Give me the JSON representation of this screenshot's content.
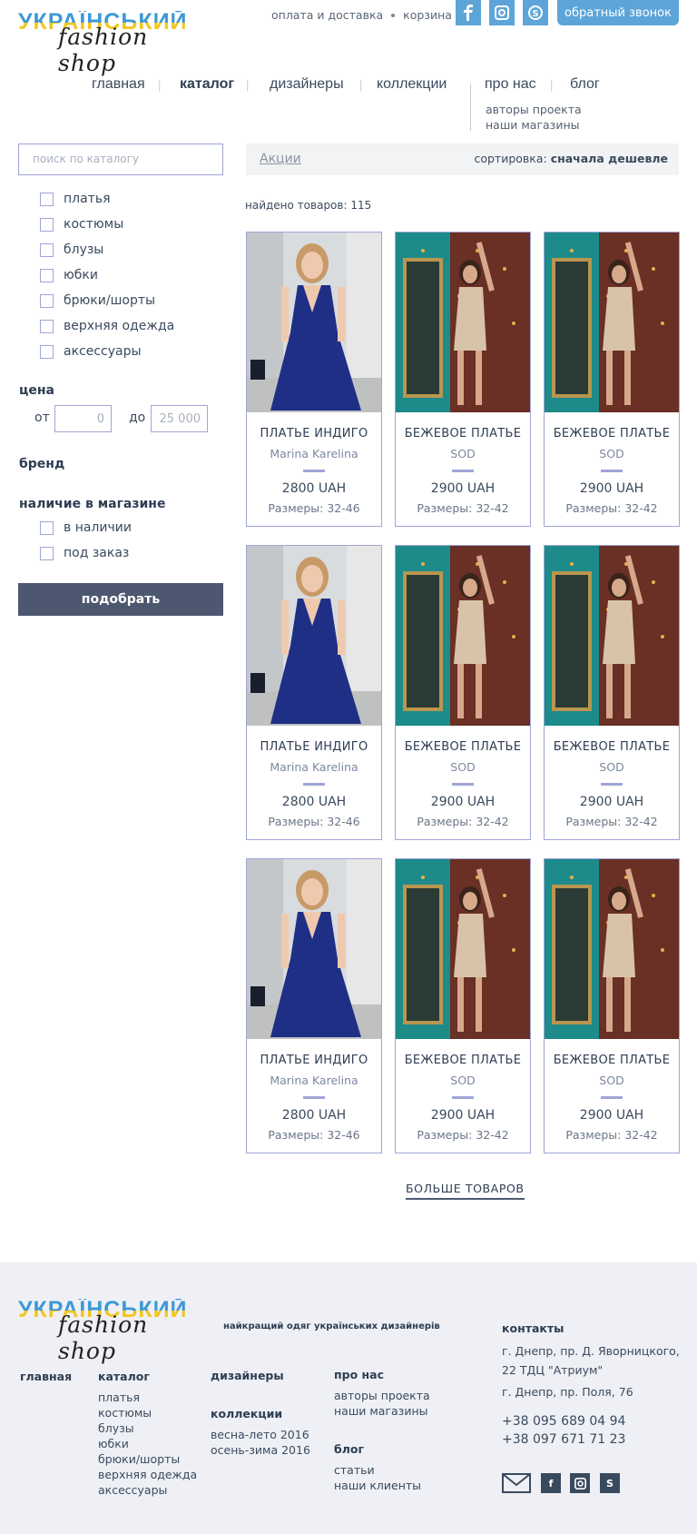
{
  "logo": {
    "line1": "УКРАЇНСЬКИЙ",
    "line2": "fashion shop"
  },
  "header": {
    "delivery_link": "оплата и доставка",
    "cart_link": "корзина (0)",
    "callback_button": "обратный звонок",
    "social": [
      "facebook-icon",
      "instagram-icon",
      "skype-icon"
    ]
  },
  "nav": {
    "items": [
      "главная",
      "каталог",
      "дизайнеры",
      "коллекции",
      "про нас",
      "блог"
    ],
    "active": "каталог",
    "sub_about": [
      "авторы проекта",
      "наши магазины"
    ]
  },
  "sidebar": {
    "search_placeholder": "поиск по каталогу",
    "categories": [
      "платья",
      "костюмы",
      "блузы",
      "юбки",
      "брюки/шорты",
      "верхняя одежда",
      "аксессуары"
    ],
    "price_label": "цена",
    "from_label": "от",
    "to_label": "до",
    "price_from": "0",
    "price_to": "25 000",
    "brand_label": "бренд",
    "stock_label": "наличие в магазине",
    "stock_options": [
      "в наличии",
      "под заказ"
    ],
    "apply_button": "подобрать"
  },
  "toolbar": {
    "promo_link": "Акции",
    "sort_label": "сортировка:",
    "sort_value": "сначала дешевле"
  },
  "found_text": "найдено товаров: 115",
  "products": [
    {
      "name": "ПЛАТЬЕ ИНДИГО",
      "brand": "Marina Karelina",
      "price": "2800 UAH",
      "sizes": "Размеры: 32-46"
    },
    {
      "name": "БЕЖЕВОЕ ПЛАТЬЕ",
      "brand": "SOD",
      "price": "2900 UAH",
      "sizes": "Размеры: 32-42"
    },
    {
      "name": "БЕЖЕВОЕ ПЛАТЬЕ",
      "brand": "SOD",
      "price": "2900 UAH",
      "sizes": "Размеры: 32-42"
    },
    {
      "name": "ПЛАТЬЕ ИНДИГО",
      "brand": "Marina Karelina",
      "price": "2800 UAH",
      "sizes": "Размеры: 32-46"
    },
    {
      "name": "БЕЖЕВОЕ ПЛАТЬЕ",
      "brand": "SOD",
      "price": "2900 UAH",
      "sizes": "Размеры: 32-42"
    },
    {
      "name": "БЕЖЕВОЕ ПЛАТЬЕ",
      "brand": "SOD",
      "price": "2900 UAH",
      "sizes": "Размеры: 32-42"
    },
    {
      "name": "ПЛАТЬЕ ИНДИГО",
      "brand": "Marina Karelina",
      "price": "2800 UAH",
      "sizes": "Размеры: 32-46"
    },
    {
      "name": "БЕЖЕВОЕ ПЛАТЬЕ",
      "brand": "SOD",
      "price": "2900 UAH",
      "sizes": "Размеры: 32-42"
    },
    {
      "name": "БЕЖЕВОЕ ПЛАТЬЕ",
      "brand": "SOD",
      "price": "2900 UAH",
      "sizes": "Размеры: 32-42"
    }
  ],
  "more_button": "БОЛЬШЕ ТОВАРОВ",
  "footer": {
    "tagline": "найкращий одяг українських дизайнерів",
    "col_main": "главная",
    "col_catalog": "каталог",
    "catalog_items": [
      "платья",
      "костюмы",
      "блузы",
      "юбки",
      "брюки/шорты",
      "верхняя одежда",
      "аксессуары"
    ],
    "col_designers": "дизайнеры",
    "col_collections": "коллекции",
    "collections_items": [
      "весна-лето 2016",
      "осень-зима 2016"
    ],
    "col_about": "про нас",
    "about_items": [
      "авторы проекта",
      "наши магазины"
    ],
    "col_blog": "блог",
    "blog_items": [
      "статьи",
      "наши клиенты"
    ],
    "contacts_title": "контакты",
    "address1": "г. Днепр, пр. Д. Яворницкого, 22 ТДЦ \"Атриум\"",
    "address2": "г. Днепр, пр. Поля, 76",
    "phone1": "+38 095 689 04 94",
    "phone2": "+38 097 671 71 23",
    "social": [
      "mail-icon",
      "facebook-icon",
      "instagram-icon",
      "skype-icon"
    ]
  },
  "colors": {
    "accent": "#5da5d8",
    "border": "#9fa6d6",
    "button": "#4d5870",
    "footer_bg": "#eef0f5"
  }
}
